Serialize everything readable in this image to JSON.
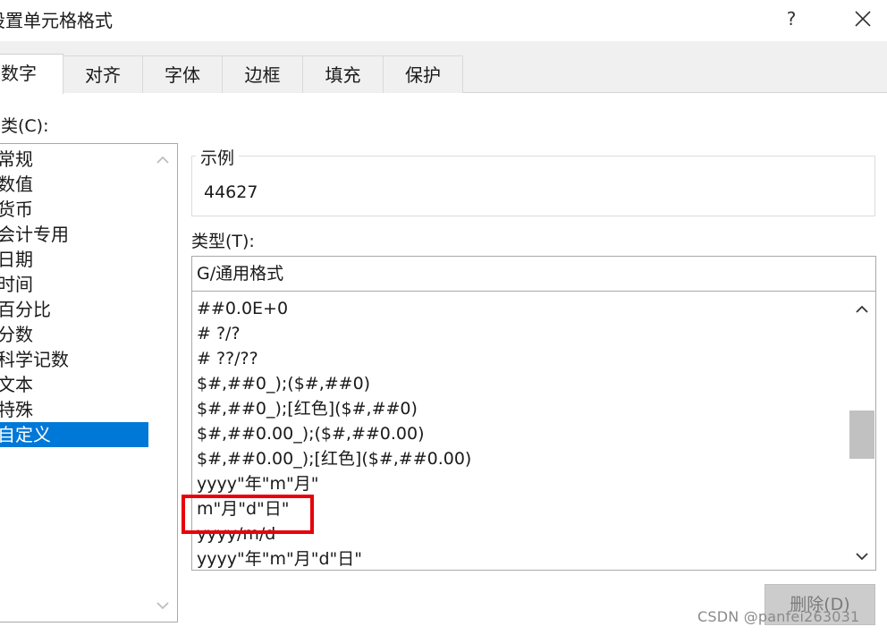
{
  "window": {
    "title": "设置单元格格式",
    "help_glyph": "?",
    "close_icon": "close-icon"
  },
  "tabs": [
    {
      "label": "数字",
      "active": true
    },
    {
      "label": "对齐",
      "active": false
    },
    {
      "label": "字体",
      "active": false
    },
    {
      "label": "边框",
      "active": false
    },
    {
      "label": "填充",
      "active": false
    },
    {
      "label": "保护",
      "active": false
    }
  ],
  "category": {
    "label": "分类(C):",
    "items": [
      "常规",
      "数值",
      "货币",
      "会计专用",
      "日期",
      "时间",
      "百分比",
      "分数",
      "科学记数",
      "文本",
      "特殊",
      "自定义"
    ],
    "selected": "自定义"
  },
  "sample": {
    "legend": "示例",
    "value": "44627"
  },
  "type": {
    "label": "类型(T):",
    "input_value": "G/通用格式",
    "formats": [
      "##0.0E+0",
      "# ?/?",
      "# ??/??",
      "$#,##0_);($#,##0)",
      "$#,##0_);[红色]($#,##0)",
      "$#,##0.00_);($#,##0.00)",
      "$#,##0.00_);[红色]($#,##0.00)",
      "yyyy\"年\"m\"月\"",
      "m\"月\"d\"日\"",
      "yyyy/m/d",
      "yyyy\"年\"m\"月\"d\"日\""
    ],
    "highlighted": "m\"月\"d\"日\""
  },
  "buttons": {
    "delete_label": "删除(D)"
  },
  "watermark": "CSDN @panfei263031",
  "colors": {
    "selection": "#0078d7",
    "highlight_box": "#e8000b",
    "disabled_button": "#cccccc"
  }
}
